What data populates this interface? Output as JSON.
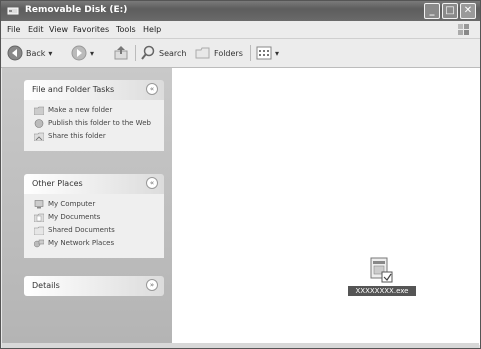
{
  "window": {
    "title": "Removable Disk (E:)",
    "minimize": "_",
    "maximize": "□",
    "close": "✕"
  },
  "menu": [
    "File",
    "Edit",
    "View",
    "Favorites",
    "Tools",
    "Help"
  ],
  "toolbar": {
    "back_label": "Back",
    "search_label": "Search",
    "folders_label": "Folders"
  },
  "left_pane": {
    "file_folder_tasks": {
      "title": "File and Folder Tasks",
      "items": [
        "Make a new folder",
        "Publish this folder to the Web",
        "Share this folder"
      ]
    },
    "other_places": {
      "title": "Other Places",
      "items": [
        "My Computer",
        "My Documents",
        "Shared Documents",
        "My Network Places"
      ]
    },
    "details": {
      "title": "Details"
    }
  },
  "content": {
    "file_label": "XXXXXXXX.exe"
  },
  "colors": {
    "titlebar": "#6a6a6a",
    "left_pane": "#c0c0c0",
    "panel_body": "#efefef"
  }
}
